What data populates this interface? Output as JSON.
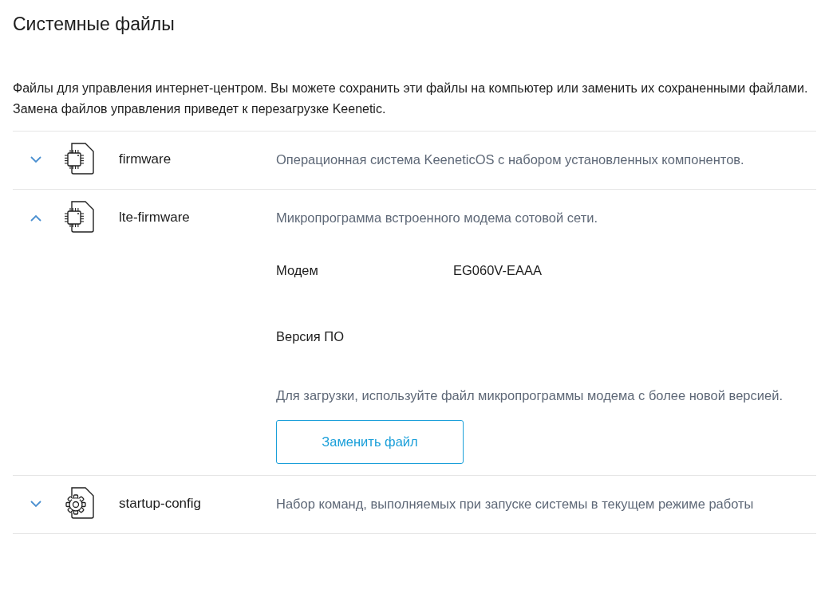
{
  "title": "Системные файлы",
  "intro": "Файлы для управления интернет-центром. Вы можете сохранить эти файлы на компьютер или заменить их сохраненными файлами. Замена файлов управления приведет к перезагрузке Keenetic.",
  "files": [
    {
      "name": "firmware",
      "kind": "chip",
      "expanded": false,
      "description": "Операционная система KeeneticOS с набором установленных компонентов."
    },
    {
      "name": "lte-firmware",
      "kind": "chip",
      "expanded": true,
      "description": "Микропрограмма встроенного модема сотовой сети.",
      "fields": [
        {
          "label": "Модем",
          "value": "EG060V-EAAA"
        },
        {
          "label": "Версия ПО"
        }
      ],
      "note": "Для загрузки, используйте файл микропрограммы модема с более новой версией.",
      "button": "Заменить файл"
    },
    {
      "name": "startup-config",
      "kind": "gear",
      "expanded": false,
      "description": "Набор команд, выполняемых при запуске системы в текущем режиме работы"
    }
  ]
}
